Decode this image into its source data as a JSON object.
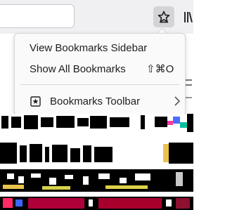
{
  "toolbar": {
    "url_value": "",
    "bookmark_star": "bookmark-star-icon",
    "library": "library-icon"
  },
  "menu": {
    "view_sidebar_label": "View Bookmarks Sidebar",
    "show_all_label": "Show All Bookmarks",
    "show_all_shortcut": "⇧⌘O",
    "bookmarks_toolbar_label": "Bookmarks Toolbar"
  },
  "colors": {
    "toolbar_bg": "#f0f0f2",
    "menu_bg": "#fafafa",
    "star_button_bg": "#d4d4d8",
    "text": "#1e1e1e"
  }
}
